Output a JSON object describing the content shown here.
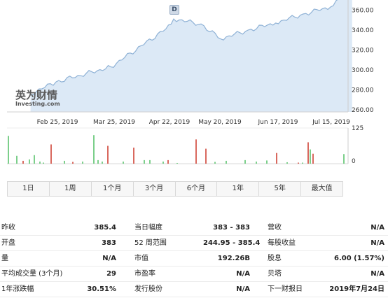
{
  "chart": {
    "y_axis_ticks": [
      "360.00",
      "340.00",
      "320.00",
      "300.00",
      "280.00",
      "260.00"
    ],
    "x_axis_dates": [
      "Feb 25, 2019",
      "Mar 25, 2019",
      "Apr 22, 2019",
      "May 20, 2019",
      "Jun 17, 2019",
      "Jul 15, 2019"
    ],
    "volume_axis_ticks": [
      "125",
      "0"
    ],
    "dividend_marker": "D",
    "watermark_cn": "英为财情",
    "watermark_en": "Investing.com",
    "area_fill_color": "#dce9f6",
    "line_color": "#8fb2d6",
    "volume_up_color": "#7ccf8b",
    "volume_down_color": "#d9695f"
  },
  "chart_data": {
    "type": "area",
    "x": [
      "Feb 12, 2019",
      "Feb 25, 2019",
      "Mar 25, 2019",
      "Apr 22, 2019",
      "Apr 26, 2019",
      "May 10, 2019",
      "May 20, 2019",
      "Jun 3, 2019",
      "Jun 17, 2019",
      "Jul 1, 2019",
      "Jul 15, 2019",
      "Jul 26, 2019"
    ],
    "y": [
      276,
      288,
      303,
      341,
      351,
      346,
      331,
      340,
      347,
      356,
      363,
      385.4
    ],
    "ylim": [
      258,
      370
    ],
    "volume_ylim": [
      0,
      125
    ],
    "grid": false
  },
  "ranges": [
    "1日",
    "1周",
    "1个月",
    "3个月",
    "6个月",
    "1年",
    "5年",
    "最大值"
  ],
  "stats": [
    [
      {
        "label": "昨收",
        "value": "385.4"
      },
      {
        "label": "当日幅度",
        "value": "383 - 383"
      },
      {
        "label": "营收",
        "value": "N/A"
      }
    ],
    [
      {
        "label": "开盘",
        "value": "383"
      },
      {
        "label": "52 周范围",
        "value": "244.95 - 385.4"
      },
      {
        "label": "每股收益",
        "value": "N/A"
      }
    ],
    [
      {
        "label": "量",
        "value": "N/A"
      },
      {
        "label": "市值",
        "value": "192.26B"
      },
      {
        "label": "股息",
        "value": "6.00 (1.57%)"
      }
    ],
    [
      {
        "label": "平均成交量 (3个月)",
        "value": "29"
      },
      {
        "label": "市盈率",
        "value": "N/A"
      },
      {
        "label": "贝塔",
        "value": "N/A"
      }
    ],
    [
      {
        "label": "1年涨跌幅",
        "value": "30.51%"
      },
      {
        "label": "发行股份",
        "value": "N/A"
      },
      {
        "label": "下一财报日",
        "value": "2019年7月24日"
      }
    ]
  ]
}
